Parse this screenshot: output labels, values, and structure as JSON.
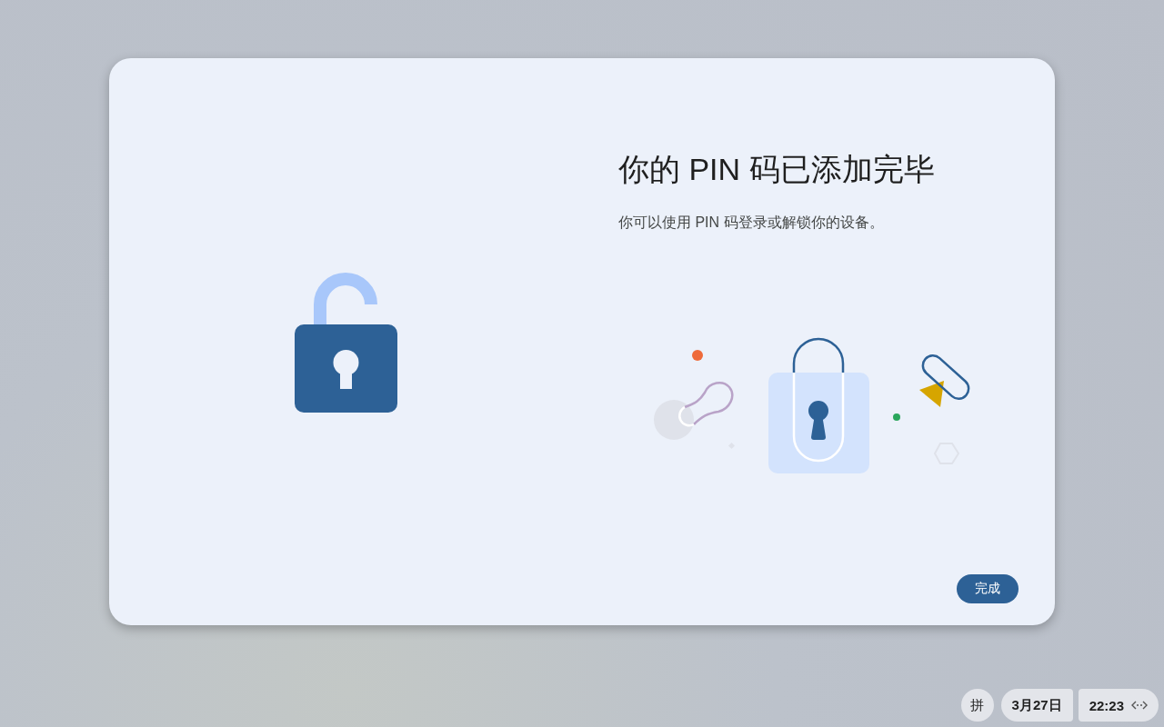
{
  "dialog": {
    "title": "你的 PIN 码已添加完毕",
    "subtitle": "你可以使用 PIN 码登录或解锁你的设备。",
    "done_button": "完成"
  },
  "shelf": {
    "ime": "拼",
    "date": "3月27日",
    "time": "22:23"
  }
}
